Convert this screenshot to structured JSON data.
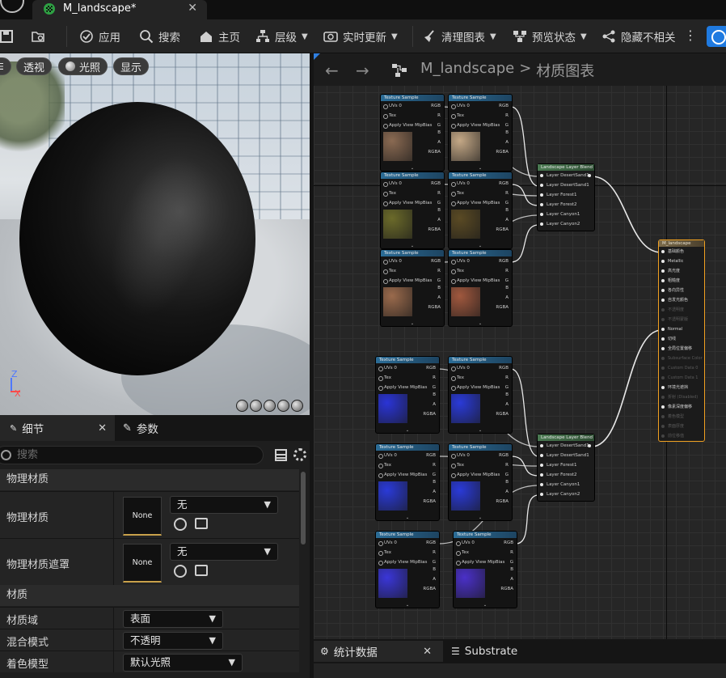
{
  "tab": {
    "title": "M_landscape*"
  },
  "toolbar": {
    "apply": "应用",
    "search": "搜索",
    "home": "主页",
    "hierarchy": "层级",
    "live_update": "实时更新",
    "clean_graph": "清理图表",
    "preview_state": "预览状态",
    "hide_unrelated": "隐藏不相关"
  },
  "viewport": {
    "perspective": "透视",
    "lighting": "光照",
    "show": "显示",
    "axis_z": "Z",
    "axis_x": "X"
  },
  "details": {
    "tab_details": "细节",
    "tab_params": "参数",
    "search_placeholder": "搜索",
    "cat_phys": "物理材质",
    "phys_mat_label": "物理材质",
    "phys_mat_thumb": "None",
    "phys_mat_value": "无",
    "phys_mask_label": "物理材质遮罩",
    "phys_mask_thumb": "None",
    "phys_mask_value": "无",
    "cat_material": "材质",
    "domain_label": "材质域",
    "domain_value": "表面",
    "blend_label": "混合模式",
    "blend_value": "不透明",
    "shading_label": "着色模型",
    "shading_value": "默认光照"
  },
  "graph": {
    "crumb_asset": "M_landscape",
    "crumb_sep": ">",
    "crumb_graph": "材质图表",
    "tex_title": "Texture Sample",
    "row_uvs": "UVs",
    "row_uvs_val": "0",
    "row_tex": "Tex",
    "row_mip": "Apply View MipBias",
    "pin_rgb": "RGB",
    "pin_r": "R",
    "pin_g": "G",
    "pin_b": "B",
    "pin_a": "A",
    "pin_rgba": "RGBA",
    "blend_title": "Landscape Layer Blend",
    "blend_layers": [
      "Layer DesertSand1",
      "Layer DesertSand1",
      "Layer Forest1",
      "Layer Forest2",
      "Layer Canyon1",
      "Layer Canyon2"
    ],
    "mat_title": "M_landscape",
    "mat_pins": [
      {
        "label": "基础颜色",
        "active": true
      },
      {
        "label": "Metallic",
        "active": true
      },
      {
        "label": "高光度",
        "active": true
      },
      {
        "label": "粗糙度",
        "active": true
      },
      {
        "label": "各向异性",
        "active": true
      },
      {
        "label": "自发光颜色",
        "active": true
      },
      {
        "label": "不透明度",
        "active": false
      },
      {
        "label": "不透明蒙版",
        "active": false
      },
      {
        "label": "Normal",
        "active": true
      },
      {
        "label": "切线",
        "active": true
      },
      {
        "label": "全局位置偏移",
        "active": true
      },
      {
        "label": "Subsurface Color",
        "active": false
      },
      {
        "label": "Custom Data 0",
        "active": false
      },
      {
        "label": "Custom Data 1",
        "active": false
      },
      {
        "label": "环境光遮挡",
        "active": true
      },
      {
        "label": "折射 (Disabled)",
        "active": false
      },
      {
        "label": "像素深度偏移",
        "active": true
      },
      {
        "label": "着色模型",
        "active": false
      },
      {
        "label": "表面厚度",
        "active": false
      },
      {
        "label": "前位移值",
        "active": false
      }
    ]
  },
  "bottom": {
    "stats": "统计数据",
    "substrate": "Substrate"
  },
  "colors": {
    "accent_blue": "#1f7ae0",
    "selection_orange": "#f0a020"
  }
}
